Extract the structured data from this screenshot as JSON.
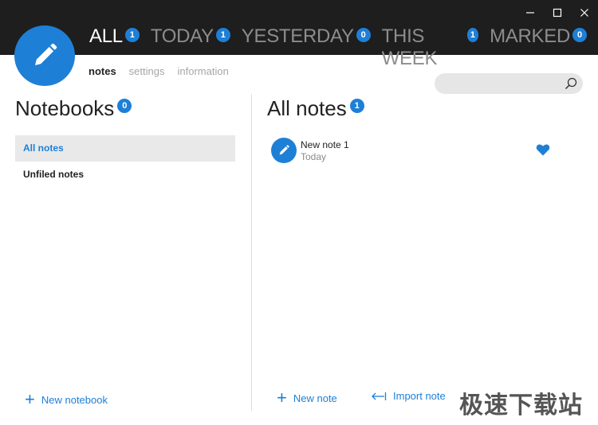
{
  "window_controls": {
    "minimize": "minimize",
    "maximize": "maximize",
    "close": "close"
  },
  "top_nav": [
    {
      "label": "ALL",
      "count": "1",
      "active": true
    },
    {
      "label": "TODAY",
      "count": "1",
      "active": false
    },
    {
      "label": "YESTERDAY",
      "count": "0",
      "active": false
    },
    {
      "label": "THIS WEEK",
      "count": "1",
      "active": false
    },
    {
      "label": "MARKED",
      "count": "0",
      "active": false
    }
  ],
  "sub_nav": [
    {
      "label": "notes",
      "active": true
    },
    {
      "label": "settings",
      "active": false
    },
    {
      "label": "information",
      "active": false
    }
  ],
  "search": {
    "placeholder": ""
  },
  "notebooks": {
    "heading": "Notebooks",
    "count": "0",
    "items": [
      {
        "label": "All notes",
        "selected": true
      },
      {
        "label": "Unfiled notes",
        "selected": false
      }
    ],
    "new_label": "New notebook"
  },
  "notes": {
    "heading": "All notes",
    "count": "1",
    "items": [
      {
        "title": "New note 1",
        "date": "Today",
        "favorite": true
      }
    ],
    "new_label": "New note",
    "import_label": "Import note"
  },
  "watermark": "极速下载站",
  "colors": {
    "accent": "#1e7fd6",
    "titlebar": "#1e1e1e",
    "inactive_nav": "#8d8d8d"
  }
}
